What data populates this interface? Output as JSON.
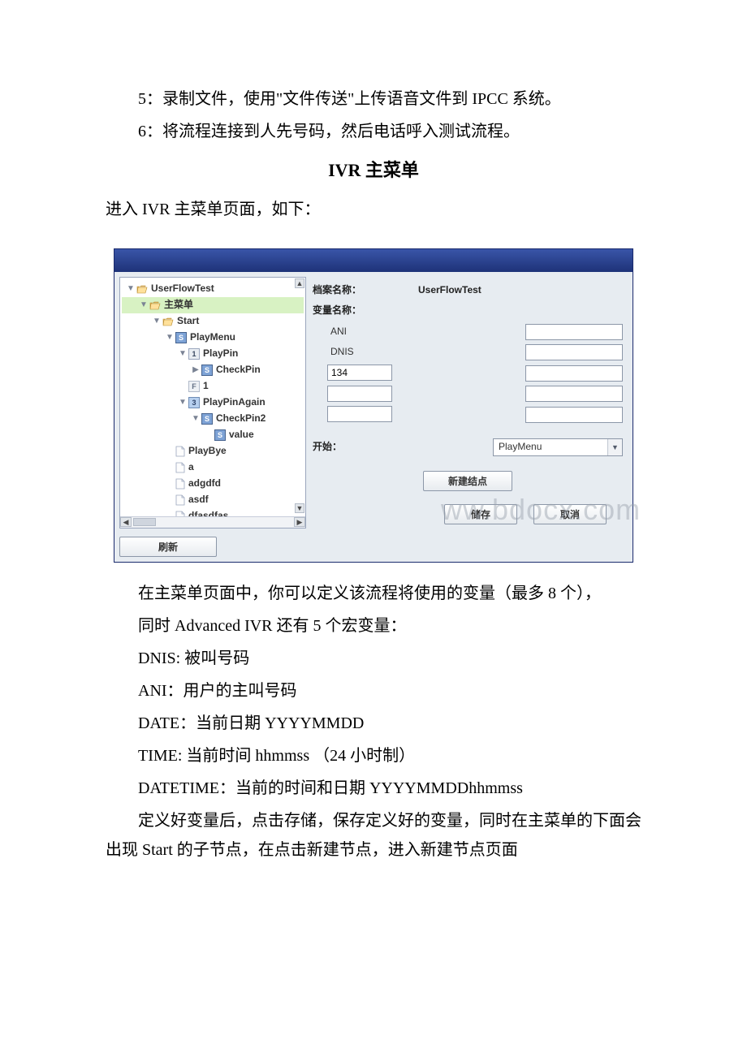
{
  "doc": {
    "line5": "5：录制文件，使用\"文件传送\"上传语音文件到 IPCC 系统。",
    "line6": "6：将流程连接到人先号码，然后电话呼入测试流程。",
    "heading_ivr": "IVR 主菜单",
    "intro": "进入 IVR 主菜单页面，如下：",
    "after1": "在主菜单页面中，你可以定义该流程将使用的变量（最多 8 个），",
    "after2": "同时 Advanced IVR 还有 5 个宏变量：",
    "macro1": "DNIS: 被叫号码",
    "macro2": "ANI：用户的主叫号码",
    "macro3": "DATE：当前日期 YYYYMMDD",
    "macro4": "TIME: 当前时间 hhmmss （24 小时制）",
    "macro5": "DATETIME：当前的时间和日期 YYYYMMDDhhmmss",
    "after3": "定义好变量后，点击存储，保存定义好的变量，同时在主菜单的下面会出现 Start 的子节点，在点击新建节点，进入新建节点页面"
  },
  "ui": {
    "tree": {
      "root": "UserFlowTest",
      "main_menu": "主菜单",
      "start": "Start",
      "playmenu": "PlayMenu",
      "playpin": "PlayPin",
      "checkpin": "CheckPin",
      "node1": "1",
      "playagain": "PlayPinAgain",
      "checkpin2": "CheckPin2",
      "value": "value",
      "playbye": "PlayBye",
      "a": "a",
      "adgdfd": "adgdfd",
      "asdf": "asdf",
      "dfasdfas": "dfasdfas"
    },
    "form": {
      "archive_label": "档案名称：",
      "archive_value": "UserFlowTest",
      "var_label": "变量名称：",
      "ani": "ANI",
      "dnis": "DNIS",
      "v134": "134",
      "start_label": "开始：",
      "start_value": "PlayMenu"
    },
    "buttons": {
      "refresh": "刷新",
      "newnode": "新建结点",
      "save": "储存",
      "cancel": "取消"
    },
    "watermark": "ww.bdocx.com",
    "icons": {
      "letter_s": "S",
      "letter_1": "1",
      "letter_3": "3",
      "letter_f": "F"
    }
  }
}
